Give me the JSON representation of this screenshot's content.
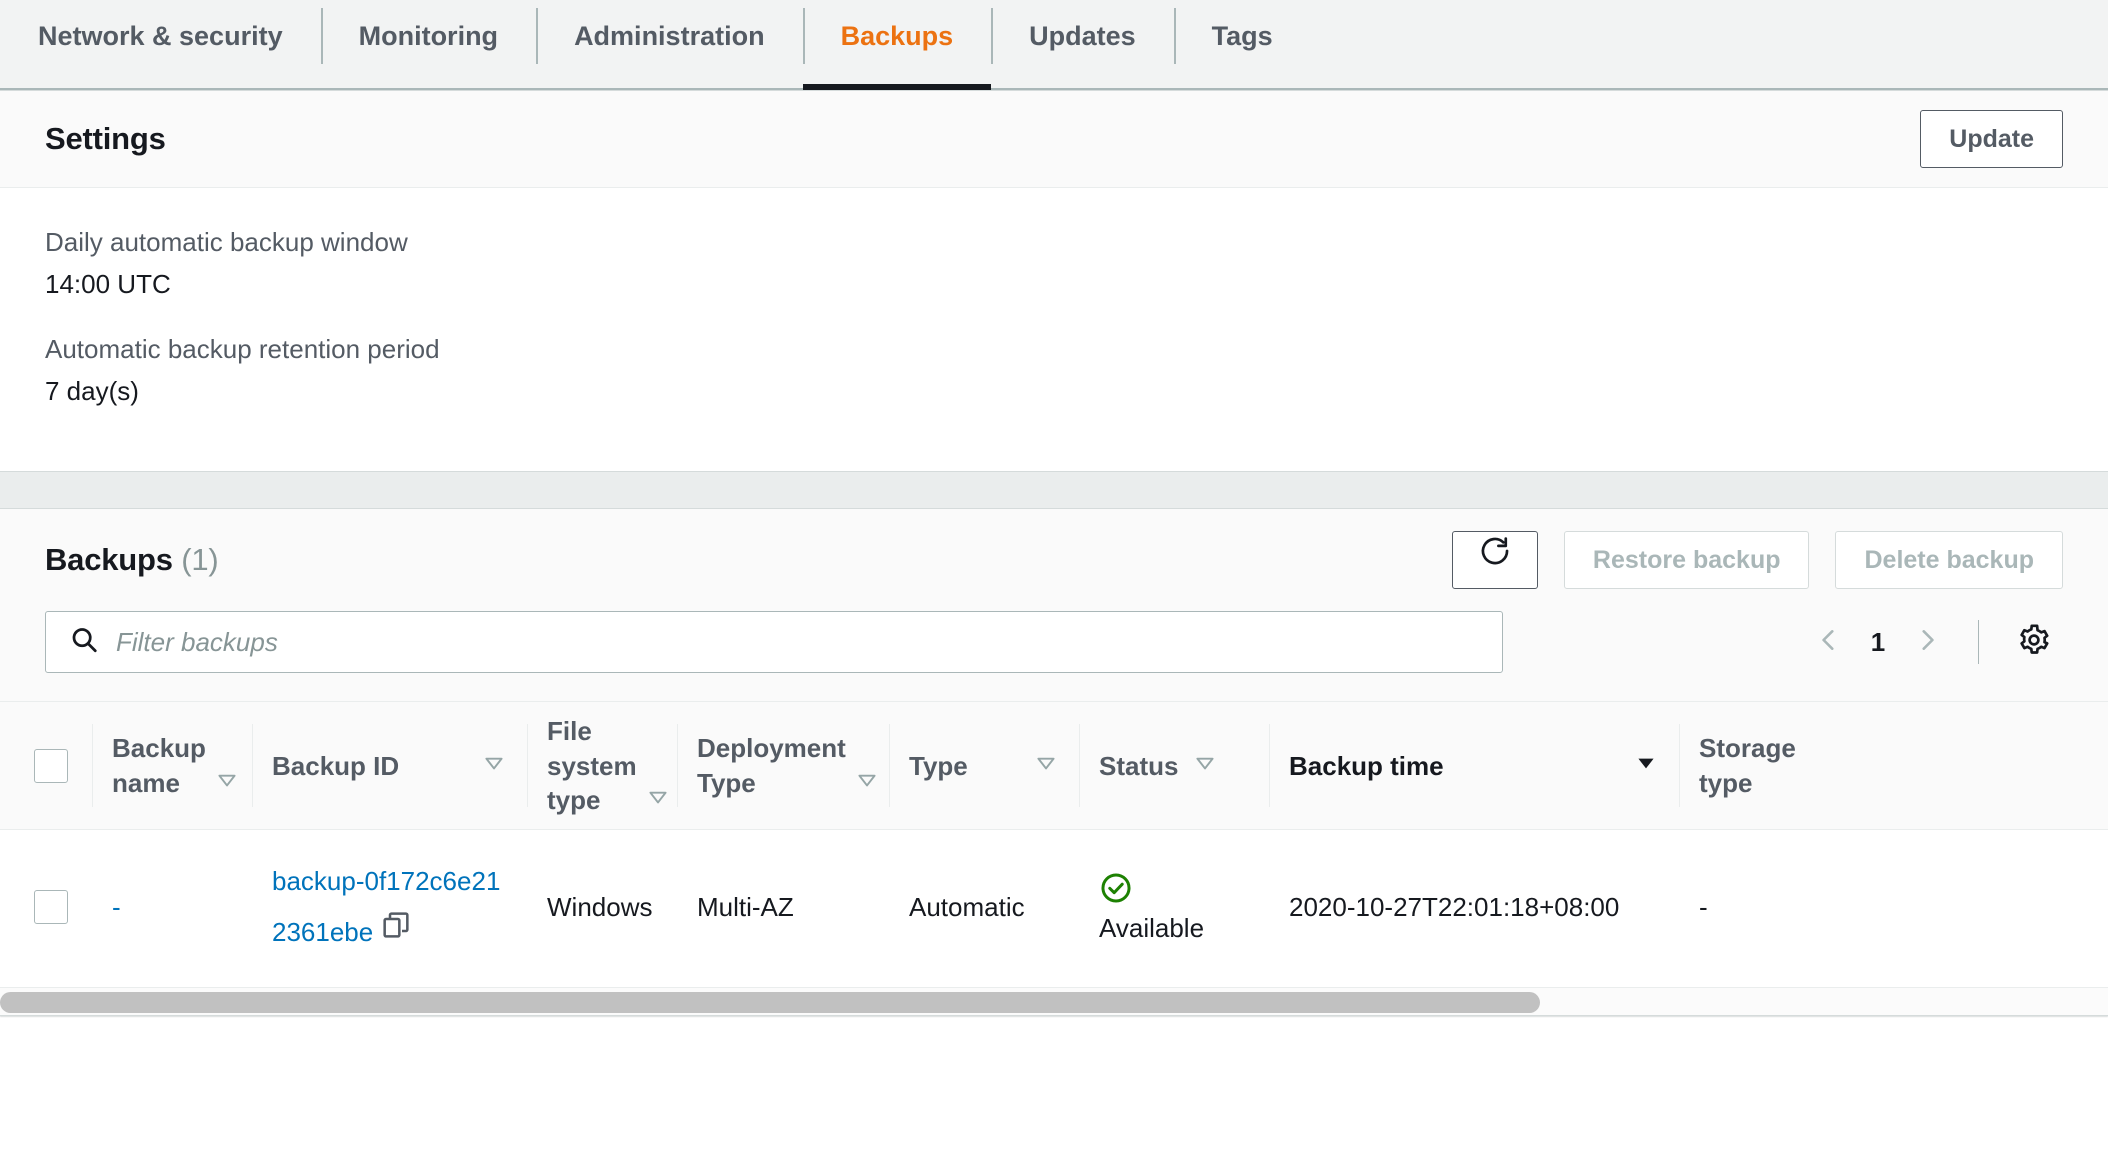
{
  "tabs": [
    {
      "label": "Network & security",
      "active": false
    },
    {
      "label": "Monitoring",
      "active": false
    },
    {
      "label": "Administration",
      "active": false
    },
    {
      "label": "Backups",
      "active": true
    },
    {
      "label": "Updates",
      "active": false
    },
    {
      "label": "Tags",
      "active": false
    }
  ],
  "settings": {
    "title": "Settings",
    "update_label": "Update",
    "fields": [
      {
        "label": "Daily automatic backup window",
        "value": "14:00 UTC"
      },
      {
        "label": "Automatic backup retention period",
        "value": "7 day(s)"
      }
    ]
  },
  "backups": {
    "title": "Backups",
    "count": "(1)",
    "refresh_icon": "refresh-icon",
    "restore_label": "Restore backup",
    "restore_disabled": true,
    "delete_label": "Delete backup",
    "delete_disabled": true,
    "search": {
      "placeholder": "Filter backups",
      "value": "",
      "icon": "search-icon"
    },
    "pagination": {
      "prev_icon": "chevron-left-icon",
      "page": "1",
      "next_icon": "chevron-right-icon",
      "settings_icon": "gear-icon"
    },
    "columns": [
      {
        "label": "Backup name",
        "sortable": true,
        "sorted": false
      },
      {
        "label": "Backup ID",
        "sortable": true,
        "sorted": false
      },
      {
        "label": "File system type",
        "sortable": true,
        "sorted": false
      },
      {
        "label": "Deployment Type",
        "sortable": true,
        "sorted": false
      },
      {
        "label": "Type",
        "sortable": true,
        "sorted": false
      },
      {
        "label": "Status",
        "sortable": true,
        "sorted": false
      },
      {
        "label": "Backup time",
        "sortable": true,
        "sorted": true
      },
      {
        "label": "Storage type",
        "sortable": false,
        "sorted": false
      }
    ],
    "rows": [
      {
        "selected": false,
        "backup_name": "-",
        "backup_id": "backup-0f172c6e212361ebe",
        "copy_icon": "copy-icon",
        "file_system_type": "Windows",
        "deployment_type": "Multi-AZ",
        "type": "Automatic",
        "status": "Available",
        "status_icon": "status-available-icon",
        "backup_time": "2020-10-27T22:01:18+08:00",
        "storage_type": "-"
      }
    ]
  },
  "colors": {
    "accent": "#ec7211",
    "link": "#0073bb",
    "text": "#16191f",
    "muted": "#545b64",
    "disabled": "#aab7b8",
    "status_available": "#1d8102",
    "page_bg": "#eaeded"
  }
}
